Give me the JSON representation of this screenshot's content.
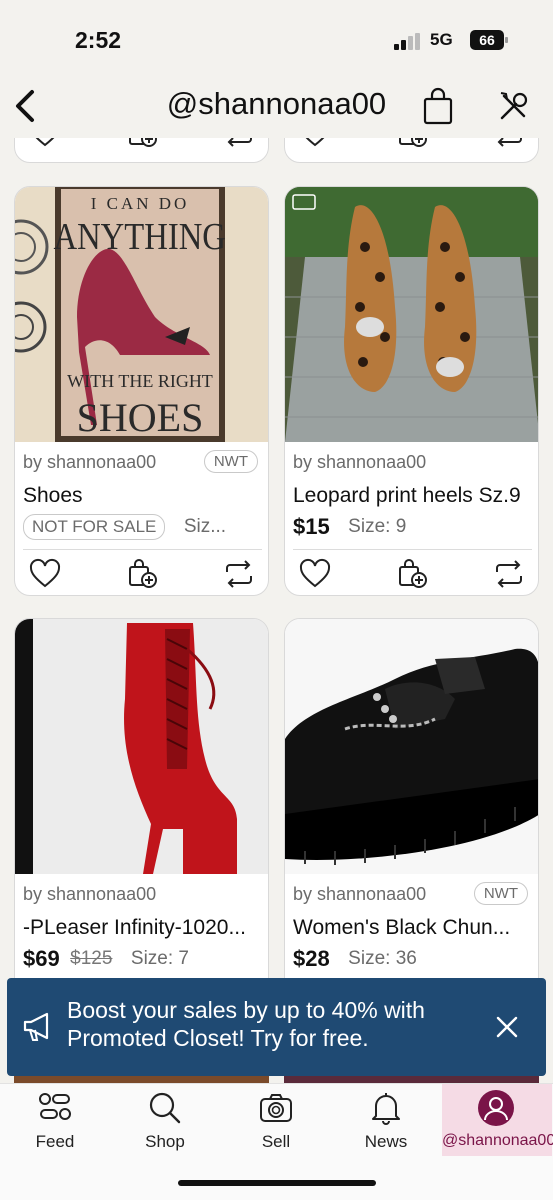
{
  "status_bar": {
    "time": "2:52",
    "network": "5G",
    "battery": "66"
  },
  "header": {
    "title": "@shannonaa00"
  },
  "listings": [
    {
      "seller": "by shannonaa00",
      "badge": "NWT",
      "title": "Shoes",
      "not_for_sale": "NOT FOR SALE",
      "size": "Siz...",
      "image_text": {
        "line1": "I CAN DO",
        "line2": "ANYTHING",
        "line3": "WITH THE RIGHT",
        "line4": "SHOES"
      }
    },
    {
      "seller": "by shannonaa00",
      "title": "Leopard print heels Sz.9",
      "price": "$15",
      "size": "Size: 9"
    },
    {
      "seller": "by shannonaa00",
      "title": "-PLeaser Infinity-1020...",
      "price": "$69",
      "original_price": "$125",
      "size": "Size: 7"
    },
    {
      "seller": "by shannonaa00",
      "badge": "NWT",
      "title": "Women's Black Chun...",
      "price": "$28",
      "size": "Size: 36"
    }
  ],
  "promo": {
    "text": "Boost your sales by up to 40% with Promoted Closet! Try for free."
  },
  "bottom_nav": [
    {
      "label": "Feed",
      "icon": "feed-icon"
    },
    {
      "label": "Shop",
      "icon": "search-icon"
    },
    {
      "label": "Sell",
      "icon": "camera-icon"
    },
    {
      "label": "News",
      "icon": "bell-icon"
    },
    {
      "label": "@shannonaa00",
      "icon": "avatar"
    }
  ],
  "colors": {
    "promo_bg": "#1f4a73",
    "accent": "#7a1448",
    "background": "#f3f2ee"
  }
}
